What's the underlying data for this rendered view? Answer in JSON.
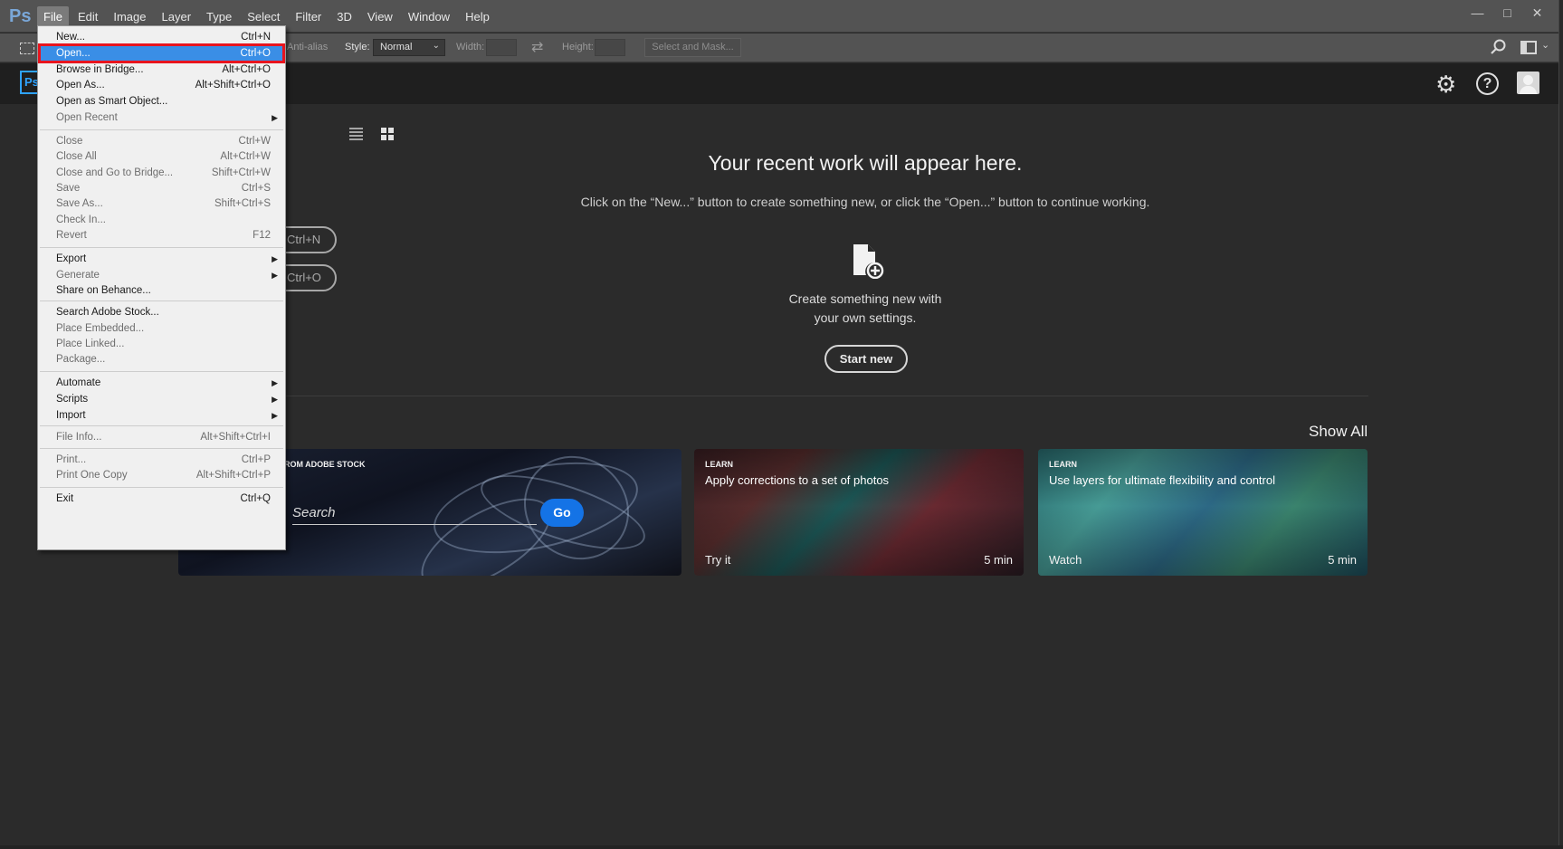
{
  "app": {
    "logo": "Ps",
    "home_logo": "Ps"
  },
  "menubar": {
    "items": [
      "File",
      "Edit",
      "Image",
      "Layer",
      "Type",
      "Select",
      "Filter",
      "3D",
      "View",
      "Window",
      "Help"
    ],
    "window_controls": {
      "minimize": "—",
      "restore": "□",
      "close": "✕"
    }
  },
  "options_bar": {
    "anti_alias": "Anti-alias",
    "style_label": "Style:",
    "style_value": "Normal",
    "width_label": "Width:",
    "height_label": "Height:",
    "select_mask": "Select and Mask..."
  },
  "home": {
    "recent_title": "Your recent work will appear here.",
    "recent_sub": "Click on the “New...” button to create something new, or click the “Open...” button to continue working.",
    "new_shortcut": "Ctrl+N",
    "open_shortcut": "Ctrl+O",
    "create_line1": "Create something new with",
    "create_line2": "your own settings.",
    "start_new": "Start new",
    "show_all": "Show All",
    "stock_card": {
      "label": "ROM ADOBE STOCK",
      "placeholder": "Search",
      "go": "Go"
    },
    "learn_cards": [
      {
        "label": "LEARN",
        "title": "Apply corrections to a set of photos",
        "action": "Try it",
        "duration": "5 min"
      },
      {
        "label": "LEARN",
        "title": "Use layers for ultimate flexibility and control",
        "action": "Watch",
        "duration": "5 min"
      }
    ]
  },
  "file_menu": {
    "items": [
      {
        "label": "New...",
        "shortcut": "Ctrl+N",
        "enabled": true
      },
      {
        "label": "Open...",
        "shortcut": "Ctrl+O",
        "enabled": true,
        "highlighted": true
      },
      {
        "label": "Browse in Bridge...",
        "shortcut": "Alt+Ctrl+O",
        "enabled": true
      },
      {
        "label": "Open As...",
        "shortcut": "Alt+Shift+Ctrl+O",
        "enabled": true
      },
      {
        "label": "Open as Smart Object...",
        "shortcut": "",
        "enabled": true
      },
      {
        "label": "Open Recent",
        "shortcut": "",
        "enabled": false,
        "submenu": true
      },
      {
        "label": "Close",
        "shortcut": "Ctrl+W",
        "enabled": false
      },
      {
        "label": "Close All",
        "shortcut": "Alt+Ctrl+W",
        "enabled": false
      },
      {
        "label": "Close and Go to Bridge...",
        "shortcut": "Shift+Ctrl+W",
        "enabled": false
      },
      {
        "label": "Save",
        "shortcut": "Ctrl+S",
        "enabled": false
      },
      {
        "label": "Save As...",
        "shortcut": "Shift+Ctrl+S",
        "enabled": false
      },
      {
        "label": "Check In...",
        "shortcut": "",
        "enabled": false
      },
      {
        "label": "Revert",
        "shortcut": "F12",
        "enabled": false
      },
      {
        "label": "Export",
        "shortcut": "",
        "enabled": true,
        "submenu": true
      },
      {
        "label": "Generate",
        "shortcut": "",
        "enabled": false,
        "submenu": true
      },
      {
        "label": "Share on Behance...",
        "shortcut": "",
        "enabled": true
      },
      {
        "label": "Search Adobe Stock...",
        "shortcut": "",
        "enabled": true
      },
      {
        "label": "Place Embedded...",
        "shortcut": "",
        "enabled": false
      },
      {
        "label": "Place Linked...",
        "shortcut": "",
        "enabled": false
      },
      {
        "label": "Package...",
        "shortcut": "",
        "enabled": false
      },
      {
        "label": "Automate",
        "shortcut": "",
        "enabled": true,
        "submenu": true
      },
      {
        "label": "Scripts",
        "shortcut": "",
        "enabled": true,
        "submenu": true
      },
      {
        "label": "Import",
        "shortcut": "",
        "enabled": true,
        "submenu": true
      },
      {
        "label": "File Info...",
        "shortcut": "Alt+Shift+Ctrl+I",
        "enabled": false
      },
      {
        "label": "Print...",
        "shortcut": "Ctrl+P",
        "enabled": false
      },
      {
        "label": "Print One Copy",
        "shortcut": "Alt+Shift+Ctrl+P",
        "enabled": false
      },
      {
        "label": "Exit",
        "shortcut": "Ctrl+Q",
        "enabled": true
      }
    ]
  },
  "colors": {
    "accent": "#1473e6",
    "highlight_outline": "#e8141e",
    "menu_bg": "#f0f0f0",
    "chrome": "#535353"
  }
}
